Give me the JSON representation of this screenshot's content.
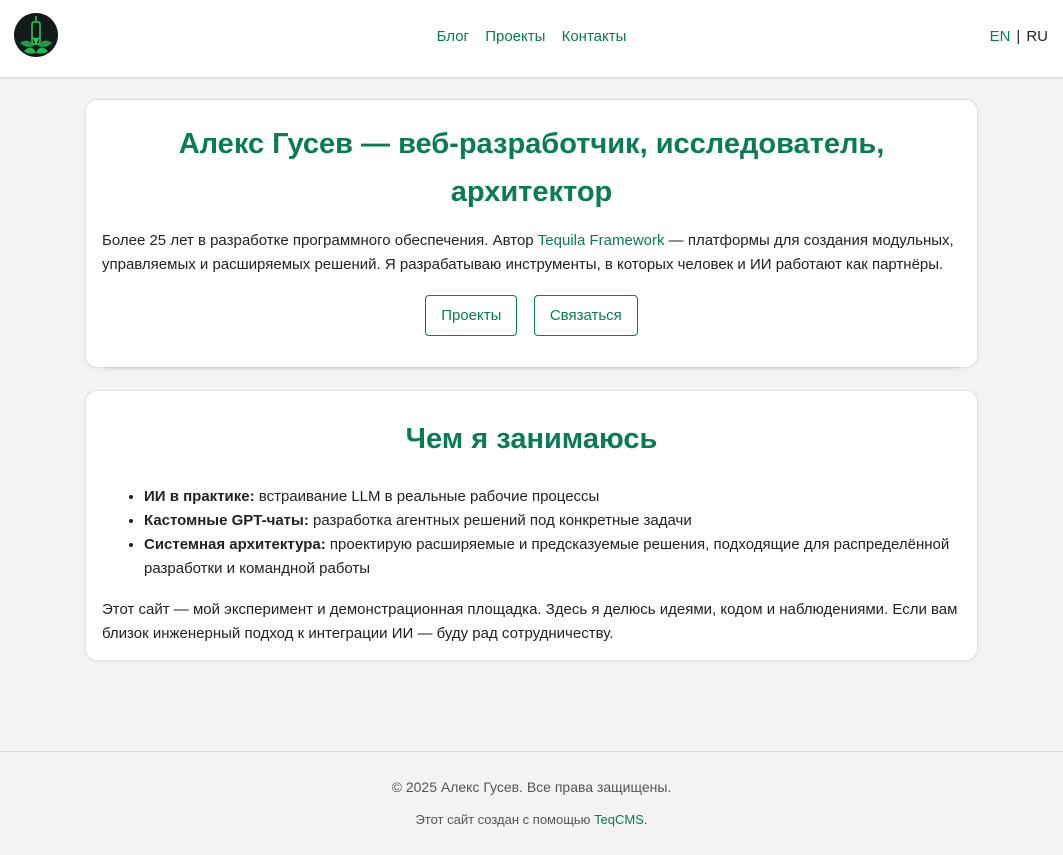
{
  "header": {
    "nav": [
      "Блог",
      "Проекты",
      "Контакты"
    ],
    "lang": {
      "en": "EN",
      "separator": "|",
      "ru": "RU"
    }
  },
  "hero": {
    "title": "Алекс Гусев — веб-разработчик, исследователь, архитектор",
    "intro_before": "Более 25 лет в разработке программного обеспечения. Автор ",
    "intro_link": "Tequila Framework",
    "intro_after": " — платформы для создания модульных, управляемых и расширяемых решений. Я разрабатываю инструменты, в которых человек и ИИ работают как партнёры.",
    "buttons": [
      "Проекты",
      "Связаться"
    ]
  },
  "about": {
    "title": "Чем я занимаюсь",
    "items": [
      {
        "label": "ИИ в практике:",
        "text": " встраивание LLM в реальные рабочие процессы"
      },
      {
        "label": "Кастомные GPT-чаты:",
        "text": " разработка агентных решений под конкретные задачи"
      },
      {
        "label": "Системная архитектура:",
        "text": " проектирую расширяемые и предсказуемые решения, подходящие для распределённой разработки и командной работы"
      }
    ],
    "outro": "Этот сайт — мой эксперимент и демонстрационная площадка. Здесь я делюсь идеями, кодом и наблюдениями. Если вам близок инженерный подход к интеграции ИИ — буду рад сотрудничеству."
  },
  "footer": {
    "copyright": "© 2025 Алекс Гусев. Все права защищены.",
    "made_before": "Этот сайт создан с помощью ",
    "made_link": "TeqCMS",
    "made_after": "."
  },
  "colors": {
    "accent": "#0b7a57",
    "background": "#f3f3f3"
  }
}
